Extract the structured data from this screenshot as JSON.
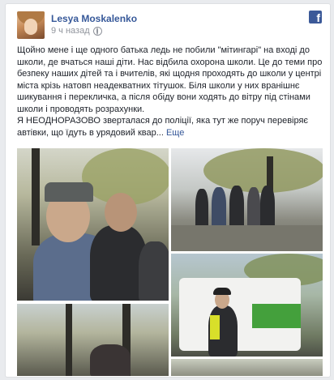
{
  "post": {
    "author": "Lesya Moskalenko",
    "time": "9 ч назад",
    "paragraphs": [
      "Щойно мене і ще одного батька ледь не побили \"мітингарі\" на вході до школи, де вчаться наші діти. Нас відбила охорона школи. Це до теми про безпеку наших дітей та і вчителів, які щодня проходять до школи у центрі міста крізь натовп неадекватних тітушок. Біля школи у них вранішнє шикування і перекличка, а після обіду вони ходять до вітру під стінами школи і проводять розрахунки.",
      "Я НЕОДНОРАЗОВО зверталася до поліції, яка тут же поруч перевіряє автівки, що їдуть в урядовий квар..."
    ],
    "more_label": "Еще"
  },
  "icons": {
    "globe": "globe-icon",
    "brand": "facebook-icon"
  },
  "colors": {
    "link": "#365899",
    "brand": "#3b5998",
    "muted": "#90949c"
  }
}
